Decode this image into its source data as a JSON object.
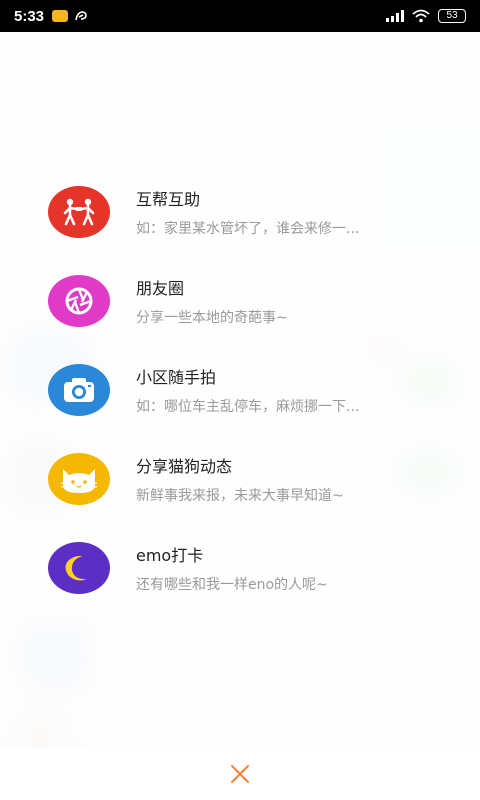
{
  "status_bar": {
    "time": "5:33",
    "battery": "53"
  },
  "menu": {
    "items": [
      {
        "title": "互帮互助",
        "subtitle": "如：家里某水管坏了，谁会来修一...",
        "icon": "helping-people-icon",
        "color": "#e5352b"
      },
      {
        "title": "朋友圈",
        "subtitle": "分享一些本地的奇葩事~",
        "icon": "camera-aperture-icon",
        "color": "#e03bc6"
      },
      {
        "title": "小区随手拍",
        "subtitle": "如：哪位车主乱停车，麻烦挪一下...",
        "icon": "camera-icon",
        "color": "#2b88d8"
      },
      {
        "title": "分享猫狗动态",
        "subtitle": "新鲜事我来报，未来大事早知道~",
        "icon": "cat-face-icon",
        "color": "#f5b800"
      },
      {
        "title": "emo打卡",
        "subtitle": "还有哪些和我一样eno的人呢~",
        "icon": "moon-icon",
        "color": "#5b2fc4"
      }
    ]
  },
  "bottom": {
    "close_icon": "close-icon",
    "close_color": "#f0843a"
  }
}
